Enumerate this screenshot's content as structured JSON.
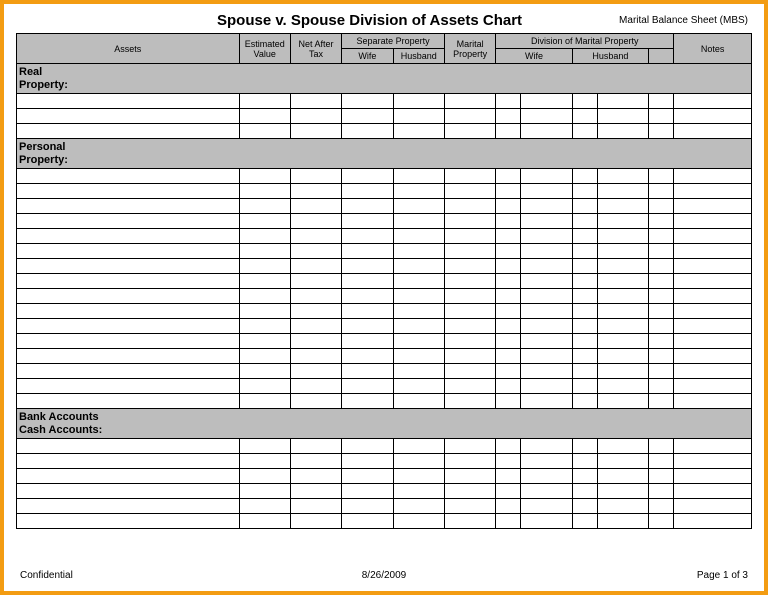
{
  "header": {
    "title": "Spouse v. Spouse Division of Assets Chart",
    "subtitle": "Marital Balance Sheet (MBS)"
  },
  "columns": {
    "assets": "Assets",
    "estimated_value": "Estimated Value",
    "net_after_tax": "Net After Tax",
    "separate_property": "Separate Property",
    "marital_property": "Marital Property",
    "division_marital_property": "Division of Marital Property",
    "notes": "Notes",
    "wife": "Wife",
    "husband": "Husband"
  },
  "sections": {
    "real_property": "Real\nProperty:",
    "personal_property": "Personal\nProperty:",
    "bank_cash": "Bank Accounts\nCash Accounts:"
  },
  "layout": {
    "rows_real": 3,
    "rows_personal": 16,
    "rows_bank": 6
  },
  "footer": {
    "left": "Confidential",
    "center": "8/26/2009",
    "right": "Page 1 of  3"
  }
}
